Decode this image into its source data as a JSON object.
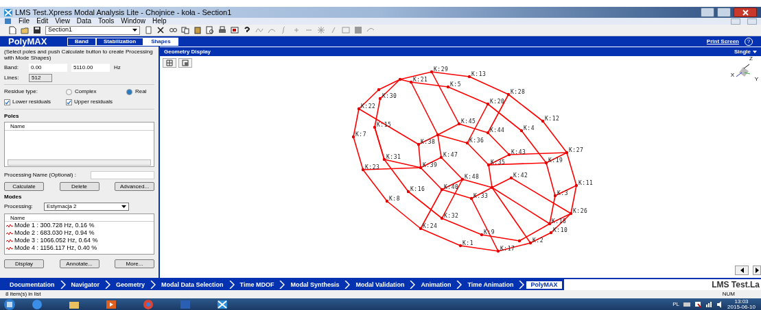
{
  "window": {
    "title": "LMS Test.Xpress Modal Analysis Lite - Chojnice - koła - Section1"
  },
  "menu": [
    "File",
    "Edit",
    "View",
    "Data",
    "Tools",
    "Window",
    "Help"
  ],
  "toolbar": {
    "section": "Section1"
  },
  "module": {
    "title": "PolyMAX",
    "print_screen": "Print Screen",
    "help": "?",
    "steps": [
      {
        "label": "Band",
        "selected": false
      },
      {
        "label": "Stabilization",
        "selected": false
      },
      {
        "label": "Shapes",
        "selected": true
      }
    ]
  },
  "left": {
    "instructions": "(Select poles and push Calculate button to create Processing with Mode Shapes)",
    "band_label": "Band:",
    "band_from": "0.00",
    "band_to": "5110.00",
    "band_unit": "Hz",
    "lines_label": "Lines:",
    "lines": "512",
    "residue_label": "Residue type:",
    "residue_options": [
      {
        "label": "Complex",
        "selected": false
      },
      {
        "label": "Real",
        "selected": true
      }
    ],
    "checks": [
      {
        "label": "Lower residuals",
        "checked": true
      },
      {
        "label": "Upper residuals",
        "checked": true
      }
    ],
    "poles_title": "Poles",
    "poles_column": "Name",
    "processing_name_label": "Processing Name (Optional) :",
    "buttons1": [
      "Calculate",
      "Delete",
      "Advanced..."
    ],
    "modes_title": "Modes",
    "processing_label": "Processing:",
    "processing_value": "Estymacja 2",
    "modes_column": "Name",
    "modes": [
      "Mode  1 : 300.728 Hz, 0.16 %",
      "Mode  2 : 683.030 Hz, 0.94 %",
      "Mode  3 : 1066.052 Hz, 0.64 %",
      "Mode  4 : 1156.117 Hz, 0.40 %"
    ],
    "buttons2": [
      "Display",
      "Annotate...",
      "More..."
    ]
  },
  "geometry": {
    "title": "Geometry Display",
    "view_mode": "Single",
    "axes": [
      "Z",
      "Y",
      "X"
    ],
    "nodes": [
      "K:29",
      "K:13",
      "K:21",
      "K:5",
      "K:30",
      "K:28",
      "K:22",
      "K:20",
      "K:12",
      "K:15",
      "K:45",
      "K:44",
      "K:4",
      "K:7",
      "K:36",
      "K:38",
      "K:27",
      "K:43",
      "K:47",
      "K:31",
      "K:19",
      "K:35",
      "K:39",
      "K:23",
      "K:42",
      "K:48",
      "K:11",
      "K:40",
      "K:16",
      "K:3",
      "K:33",
      "K:8",
      "K:26",
      "K:32",
      "K:24",
      "K:18",
      "K:10",
      "K:9",
      "K:2",
      "K:1",
      "K:17"
    ]
  },
  "nav": [
    {
      "label": "Documentation",
      "selected": false
    },
    {
      "label": "Navigator",
      "selected": false
    },
    {
      "label": "Geometry",
      "selected": false
    },
    {
      "label": "Modal Data Selection",
      "selected": false
    },
    {
      "label": "Time MDOF",
      "selected": false
    },
    {
      "label": "Modal Synthesis",
      "selected": false
    },
    {
      "label": "Modal Validation",
      "selected": false
    },
    {
      "label": "Animation",
      "selected": false
    },
    {
      "label": "Time Animation",
      "selected": false
    },
    {
      "label": "PolyMAX",
      "selected": true
    }
  ],
  "brand": "LMS Test.La",
  "status_bar": {
    "text": "8 item(s) in list",
    "num": "NUM"
  },
  "taskbar": {
    "language": "PL",
    "time": "13:03",
    "date": "2015-06-10"
  }
}
